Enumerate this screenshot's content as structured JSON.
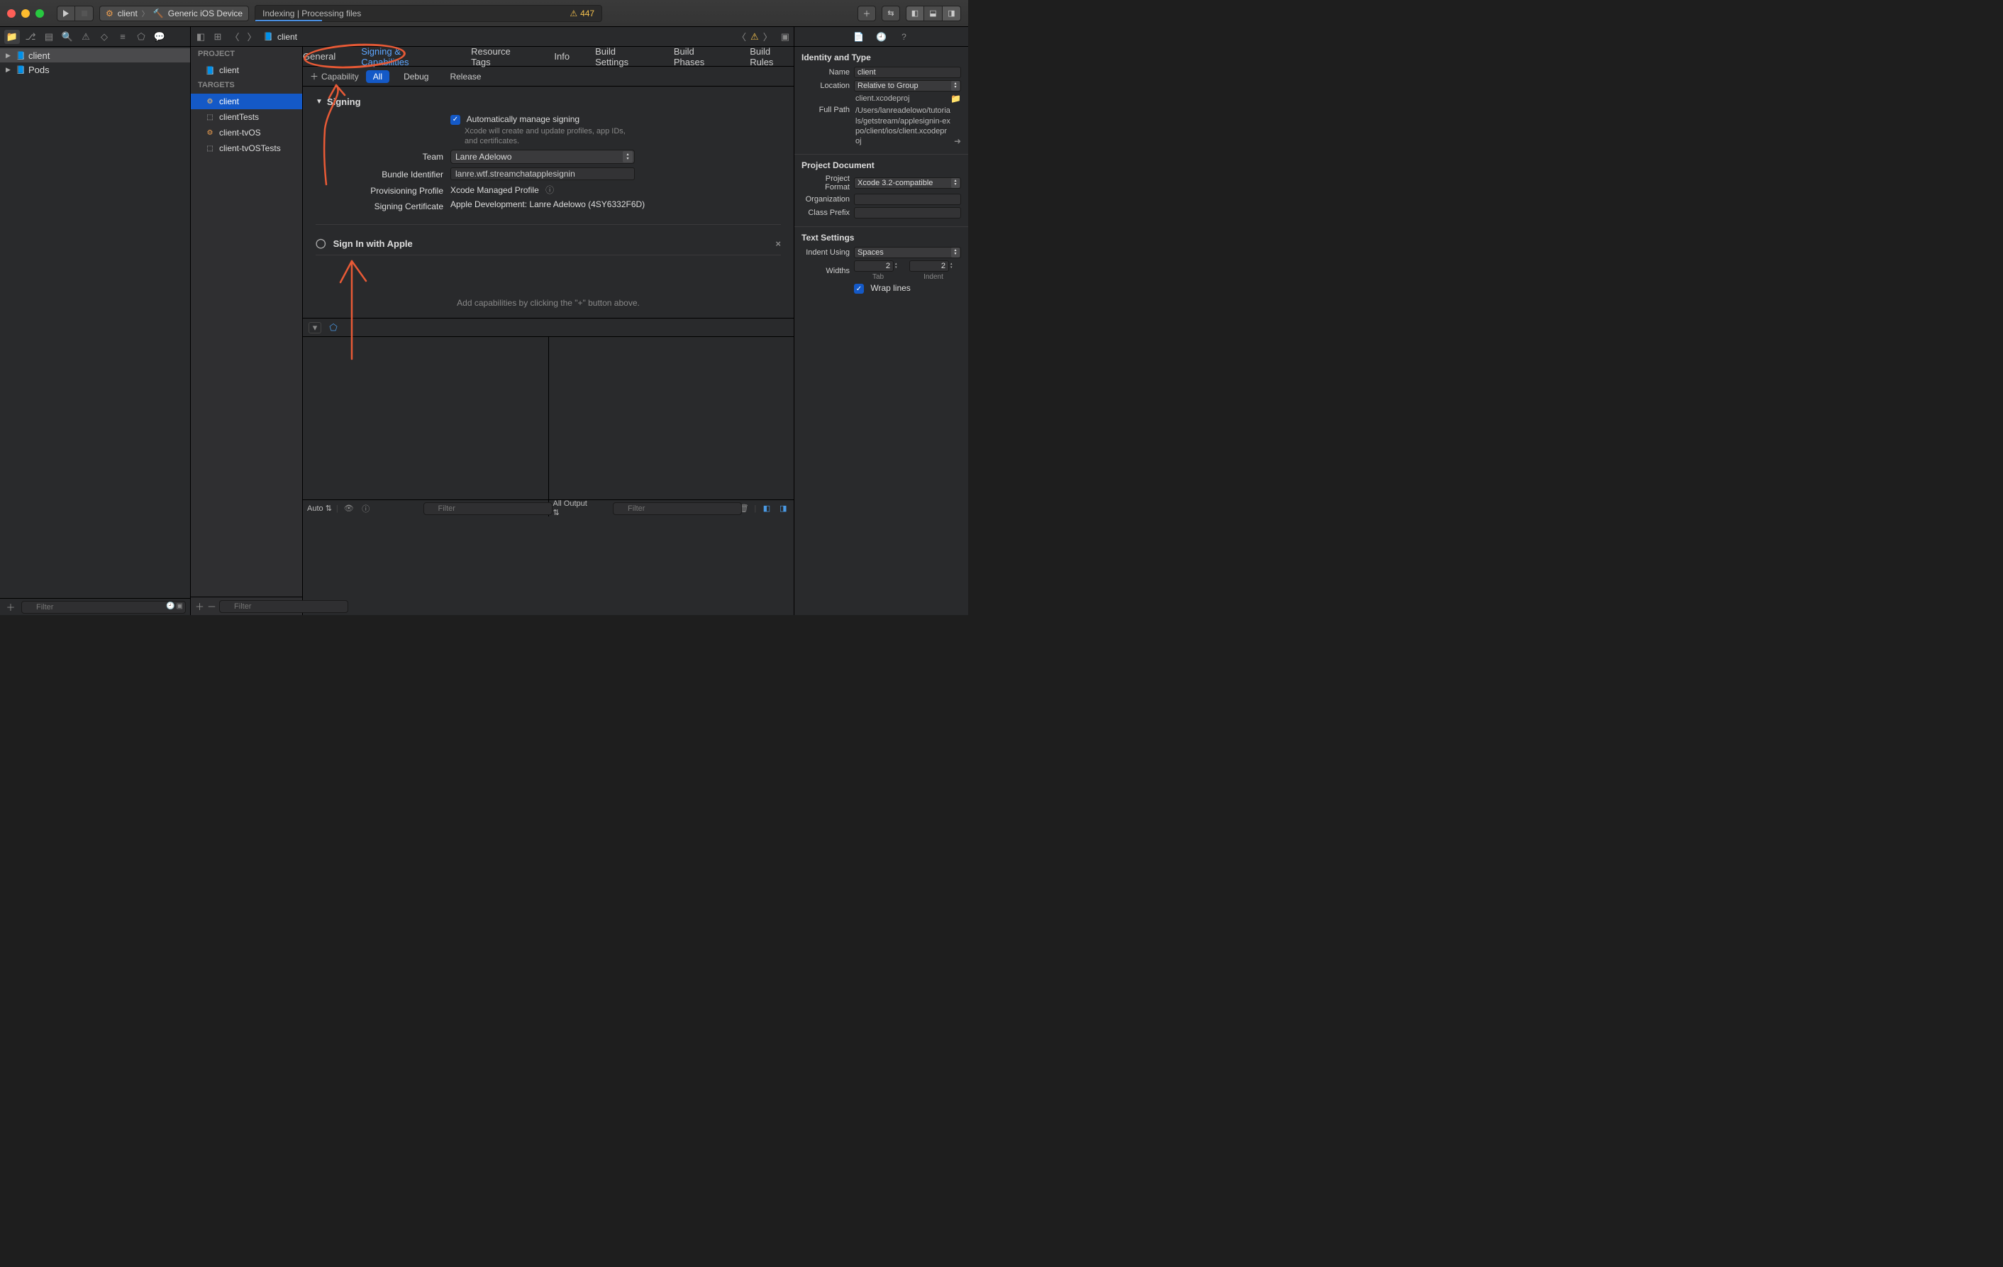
{
  "toolbar": {
    "scheme_target": "client",
    "scheme_dest": "Generic iOS Device",
    "status_text": "Indexing | Processing files",
    "warnings": "447",
    "play_label": "Run",
    "stop_label": "Stop"
  },
  "navigator": {
    "items": [
      {
        "label": "client",
        "icon": "proj",
        "sel": true
      },
      {
        "label": "Pods",
        "icon": "proj",
        "sel": false
      }
    ],
    "add_label": "+",
    "filter_placeholder": "Filter"
  },
  "jump_bar": {
    "path_label": "client"
  },
  "outline": {
    "project_header": "PROJECT",
    "project_item": "client",
    "targets_header": "TARGETS",
    "targets": [
      {
        "label": "client",
        "icon": "app",
        "sel": true
      },
      {
        "label": "clientTests",
        "icon": "test",
        "sel": false
      },
      {
        "label": "client-tvOS",
        "icon": "app",
        "sel": false
      },
      {
        "label": "client-tvOSTests",
        "icon": "test",
        "sel": false
      }
    ],
    "filter_placeholder": "Filter"
  },
  "detail_tabs": {
    "items": [
      "General",
      "Signing & Capabilities",
      "Resource Tags",
      "Info",
      "Build Settings",
      "Build Phases",
      "Build Rules"
    ],
    "active": 1
  },
  "subtabs": {
    "capability_label": "Capability",
    "items": [
      "All",
      "Debug",
      "Release"
    ],
    "active": 0
  },
  "signing": {
    "header": "Signing",
    "auto_label": "Automatically manage signing",
    "auto_help": "Xcode will create and update profiles, app IDs, and certificates.",
    "team_label": "Team",
    "team_value": "Lanre Adelowo",
    "bundle_label": "Bundle Identifier",
    "bundle_value": "lanre.wtf.streamchatapplesignin",
    "prov_label": "Provisioning Profile",
    "prov_value": "Xcode Managed Profile",
    "cert_label": "Signing Certificate",
    "cert_value": "Apple Development: Lanre Adelowo (4SY6332F6D)"
  },
  "capability": {
    "name": "Sign In with Apple"
  },
  "placeholder_text": "Add capabilities by clicking the \"+\" button above.",
  "debug": {
    "vars_scope": "Auto",
    "console_scope": "All Output",
    "filter_placeholder": "Filter"
  },
  "inspector": {
    "identity_title": "Identity and Type",
    "name_label": "Name",
    "name_value": "client",
    "location_label": "Location",
    "location_value": "Relative to Group",
    "location_file": "client.xcodeproj",
    "fullpath_label": "Full Path",
    "fullpath_value": "/Users/lanreadelowo/tutorials/getstream/applesignin-expo/client/ios/client.xcodeproj",
    "projdoc_title": "Project Document",
    "format_label": "Project Format",
    "format_value": "Xcode 3.2-compatible",
    "org_label": "Organization",
    "org_value": "",
    "prefix_label": "Class Prefix",
    "prefix_value": "",
    "text_title": "Text Settings",
    "indent_label": "Indent Using",
    "indent_value": "Spaces",
    "widths_label": "Widths",
    "tab_value": "2",
    "tab_sublabel": "Tab",
    "indentw_value": "2",
    "indentw_sublabel": "Indent",
    "wrap_label": "Wrap lines"
  }
}
